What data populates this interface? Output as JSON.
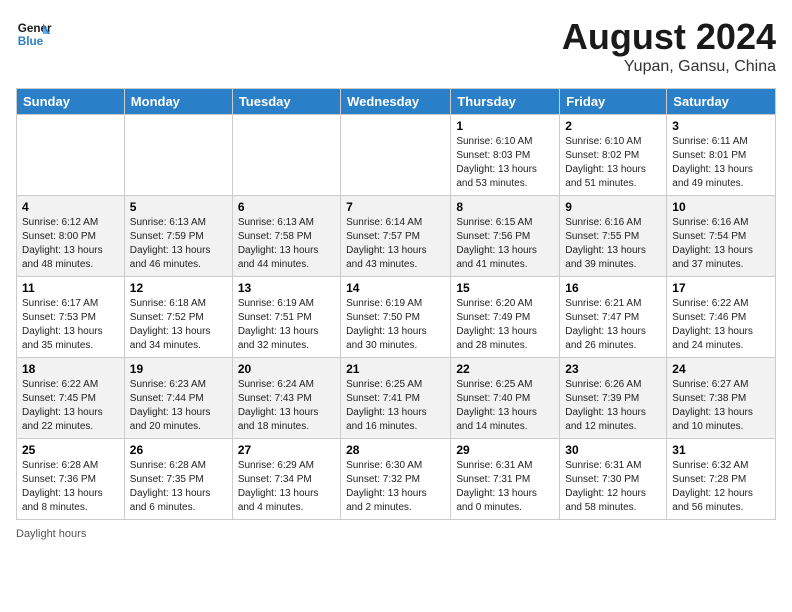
{
  "header": {
    "logo_line1": "General",
    "logo_line2": "Blue",
    "month_year": "August 2024",
    "location": "Yupan, Gansu, China"
  },
  "days_of_week": [
    "Sunday",
    "Monday",
    "Tuesday",
    "Wednesday",
    "Thursday",
    "Friday",
    "Saturday"
  ],
  "weeks": [
    [
      {
        "day": "",
        "sunrise": "",
        "sunset": "",
        "daylight": ""
      },
      {
        "day": "",
        "sunrise": "",
        "sunset": "",
        "daylight": ""
      },
      {
        "day": "",
        "sunrise": "",
        "sunset": "",
        "daylight": ""
      },
      {
        "day": "",
        "sunrise": "",
        "sunset": "",
        "daylight": ""
      },
      {
        "day": "1",
        "sunrise": "Sunrise: 6:10 AM",
        "sunset": "Sunset: 8:03 PM",
        "daylight": "Daylight: 13 hours and 53 minutes."
      },
      {
        "day": "2",
        "sunrise": "Sunrise: 6:10 AM",
        "sunset": "Sunset: 8:02 PM",
        "daylight": "Daylight: 13 hours and 51 minutes."
      },
      {
        "day": "3",
        "sunrise": "Sunrise: 6:11 AM",
        "sunset": "Sunset: 8:01 PM",
        "daylight": "Daylight: 13 hours and 49 minutes."
      }
    ],
    [
      {
        "day": "4",
        "sunrise": "Sunrise: 6:12 AM",
        "sunset": "Sunset: 8:00 PM",
        "daylight": "Daylight: 13 hours and 48 minutes."
      },
      {
        "day": "5",
        "sunrise": "Sunrise: 6:13 AM",
        "sunset": "Sunset: 7:59 PM",
        "daylight": "Daylight: 13 hours and 46 minutes."
      },
      {
        "day": "6",
        "sunrise": "Sunrise: 6:13 AM",
        "sunset": "Sunset: 7:58 PM",
        "daylight": "Daylight: 13 hours and 44 minutes."
      },
      {
        "day": "7",
        "sunrise": "Sunrise: 6:14 AM",
        "sunset": "Sunset: 7:57 PM",
        "daylight": "Daylight: 13 hours and 43 minutes."
      },
      {
        "day": "8",
        "sunrise": "Sunrise: 6:15 AM",
        "sunset": "Sunset: 7:56 PM",
        "daylight": "Daylight: 13 hours and 41 minutes."
      },
      {
        "day": "9",
        "sunrise": "Sunrise: 6:16 AM",
        "sunset": "Sunset: 7:55 PM",
        "daylight": "Daylight: 13 hours and 39 minutes."
      },
      {
        "day": "10",
        "sunrise": "Sunrise: 6:16 AM",
        "sunset": "Sunset: 7:54 PM",
        "daylight": "Daylight: 13 hours and 37 minutes."
      }
    ],
    [
      {
        "day": "11",
        "sunrise": "Sunrise: 6:17 AM",
        "sunset": "Sunset: 7:53 PM",
        "daylight": "Daylight: 13 hours and 35 minutes."
      },
      {
        "day": "12",
        "sunrise": "Sunrise: 6:18 AM",
        "sunset": "Sunset: 7:52 PM",
        "daylight": "Daylight: 13 hours and 34 minutes."
      },
      {
        "day": "13",
        "sunrise": "Sunrise: 6:19 AM",
        "sunset": "Sunset: 7:51 PM",
        "daylight": "Daylight: 13 hours and 32 minutes."
      },
      {
        "day": "14",
        "sunrise": "Sunrise: 6:19 AM",
        "sunset": "Sunset: 7:50 PM",
        "daylight": "Daylight: 13 hours and 30 minutes."
      },
      {
        "day": "15",
        "sunrise": "Sunrise: 6:20 AM",
        "sunset": "Sunset: 7:49 PM",
        "daylight": "Daylight: 13 hours and 28 minutes."
      },
      {
        "day": "16",
        "sunrise": "Sunrise: 6:21 AM",
        "sunset": "Sunset: 7:47 PM",
        "daylight": "Daylight: 13 hours and 26 minutes."
      },
      {
        "day": "17",
        "sunrise": "Sunrise: 6:22 AM",
        "sunset": "Sunset: 7:46 PM",
        "daylight": "Daylight: 13 hours and 24 minutes."
      }
    ],
    [
      {
        "day": "18",
        "sunrise": "Sunrise: 6:22 AM",
        "sunset": "Sunset: 7:45 PM",
        "daylight": "Daylight: 13 hours and 22 minutes."
      },
      {
        "day": "19",
        "sunrise": "Sunrise: 6:23 AM",
        "sunset": "Sunset: 7:44 PM",
        "daylight": "Daylight: 13 hours and 20 minutes."
      },
      {
        "day": "20",
        "sunrise": "Sunrise: 6:24 AM",
        "sunset": "Sunset: 7:43 PM",
        "daylight": "Daylight: 13 hours and 18 minutes."
      },
      {
        "day": "21",
        "sunrise": "Sunrise: 6:25 AM",
        "sunset": "Sunset: 7:41 PM",
        "daylight": "Daylight: 13 hours and 16 minutes."
      },
      {
        "day": "22",
        "sunrise": "Sunrise: 6:25 AM",
        "sunset": "Sunset: 7:40 PM",
        "daylight": "Daylight: 13 hours and 14 minutes."
      },
      {
        "day": "23",
        "sunrise": "Sunrise: 6:26 AM",
        "sunset": "Sunset: 7:39 PM",
        "daylight": "Daylight: 13 hours and 12 minutes."
      },
      {
        "day": "24",
        "sunrise": "Sunrise: 6:27 AM",
        "sunset": "Sunset: 7:38 PM",
        "daylight": "Daylight: 13 hours and 10 minutes."
      }
    ],
    [
      {
        "day": "25",
        "sunrise": "Sunrise: 6:28 AM",
        "sunset": "Sunset: 7:36 PM",
        "daylight": "Daylight: 13 hours and 8 minutes."
      },
      {
        "day": "26",
        "sunrise": "Sunrise: 6:28 AM",
        "sunset": "Sunset: 7:35 PM",
        "daylight": "Daylight: 13 hours and 6 minutes."
      },
      {
        "day": "27",
        "sunrise": "Sunrise: 6:29 AM",
        "sunset": "Sunset: 7:34 PM",
        "daylight": "Daylight: 13 hours and 4 minutes."
      },
      {
        "day": "28",
        "sunrise": "Sunrise: 6:30 AM",
        "sunset": "Sunset: 7:32 PM",
        "daylight": "Daylight: 13 hours and 2 minutes."
      },
      {
        "day": "29",
        "sunrise": "Sunrise: 6:31 AM",
        "sunset": "Sunset: 7:31 PM",
        "daylight": "Daylight: 13 hours and 0 minutes."
      },
      {
        "day": "30",
        "sunrise": "Sunrise: 6:31 AM",
        "sunset": "Sunset: 7:30 PM",
        "daylight": "Daylight: 12 hours and 58 minutes."
      },
      {
        "day": "31",
        "sunrise": "Sunrise: 6:32 AM",
        "sunset": "Sunset: 7:28 PM",
        "daylight": "Daylight: 12 hours and 56 minutes."
      }
    ]
  ],
  "footer": {
    "daylight_label": "Daylight hours"
  }
}
